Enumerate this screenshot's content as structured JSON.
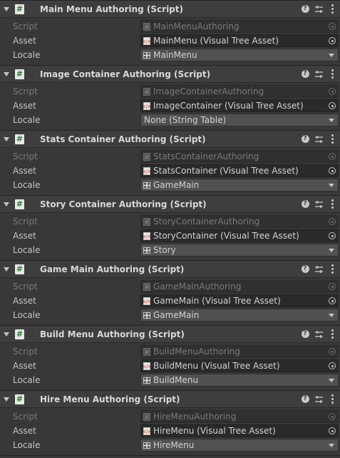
{
  "labels": {
    "script": "Script",
    "asset": "Asset",
    "locale": "Locale"
  },
  "icons": {
    "foldout": "chevron-down-icon",
    "script": "csharp-script-icon",
    "help": "help-icon",
    "preset": "preset-sliders-icon",
    "menu": "kebab-menu-icon",
    "uxml": "uxml-asset-icon",
    "string_table": "string-table-icon",
    "picker": "object-picker-icon"
  },
  "colors": {
    "background": "#383838",
    "header": "#3e3e3e",
    "field": "#2a2a2a",
    "dropdown": "#515151",
    "script_icon_hash": "#2e7d32"
  },
  "components": [
    {
      "title": "Main Menu Authoring (Script)",
      "script": "MainMenuAuthoring",
      "asset": "MainMenu (Visual Tree Asset)",
      "locale": "MainMenu",
      "locale_has_icon": true
    },
    {
      "title": "Image Container Authoring (Script)",
      "script": "ImageContainerAuthoring",
      "asset": "ImageContainer (Visual Tree Asset)",
      "locale": "None (String Table)",
      "locale_has_icon": false
    },
    {
      "title": "Stats Container Authoring (Script)",
      "script": "StatsContainerAuthoring",
      "asset": "StatsContainer (Visual Tree Asset)",
      "locale": "GameMain",
      "locale_has_icon": true
    },
    {
      "title": "Story Container Authoring (Script)",
      "script": "StoryContainerAuthoring",
      "asset": "StoryContainer (Visual Tree Asset)",
      "locale": "Story",
      "locale_has_icon": true
    },
    {
      "title": "Game Main Authoring (Script)",
      "script": "GameMainAuthoring",
      "asset": "GameMain (Visual Tree Asset)",
      "locale": "GameMain",
      "locale_has_icon": true
    },
    {
      "title": "Build Menu Authoring (Script)",
      "script": "BuildMenuAuthoring",
      "asset": "BuildMenu (Visual Tree Asset)",
      "locale": "BuildMenu",
      "locale_has_icon": true
    },
    {
      "title": "Hire Menu Authoring (Script)",
      "script": "HireMenuAuthoring",
      "asset": "HireMenu (Visual Tree Asset)",
      "locale": "HireMenu",
      "locale_has_icon": true
    }
  ]
}
